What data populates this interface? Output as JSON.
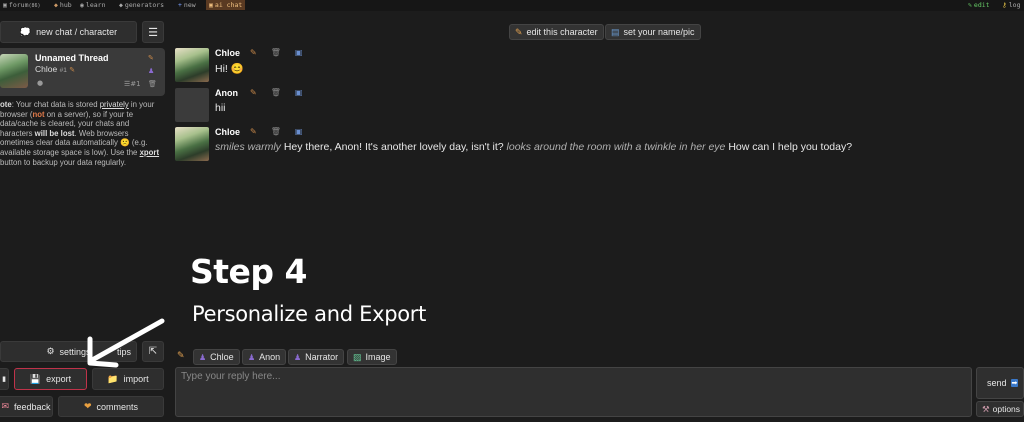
{
  "topnav": {
    "items": [
      {
        "icon": "▣",
        "label": "forum",
        "badge": "(86)"
      },
      {
        "icon": "◆",
        "label": "hub"
      },
      {
        "icon": "◉",
        "label": "learn"
      },
      {
        "icon": "◆",
        "label": "generators"
      },
      {
        "icon": "+",
        "label": "new"
      },
      {
        "icon": "▣",
        "label": "ai chat"
      }
    ],
    "right": [
      {
        "icon": "✎",
        "label": "edit"
      },
      {
        "icon": "⚷",
        "label": "log"
      }
    ]
  },
  "sidebar": {
    "new_chat_label": "new chat / character",
    "menu_icon": "☰",
    "thread": {
      "title": "Unnamed Thread",
      "character": "Chloe",
      "num": "#1",
      "msg_count": "#1"
    },
    "note": {
      "p1": "ote",
      "p2": ": Your chat data is stored ",
      "privately": "privately",
      "p3": " in your browser (",
      "not": "not",
      "p4": " on a server), so if your te data/cache is cleared, your chats and haracters ",
      "will_be_lost": "will be lost",
      "p5": ". Web browsers ometimes clear data automatically 🙁 (e.g. available storage space is low). Use the ",
      "export": "xport",
      "p6": " button to backup your data regularly."
    },
    "settings_label": "settings",
    "tips_label": "tips",
    "collapse_icon": "⇱",
    "export_label": "export",
    "import_label": "import",
    "feedback_label": "feedback",
    "comments_label": "comments"
  },
  "header": {
    "edit_character_label": "edit this character",
    "set_name_label": "set your name/pic"
  },
  "messages": [
    {
      "name": "Chloe",
      "text": "Hi! 😊"
    },
    {
      "name": "Anon",
      "text": "hii"
    },
    {
      "name": "Chloe",
      "action1": "smiles warmly",
      "speech1": " Hey there, Anon! It's another lovely day, isn't it? ",
      "action2": "looks around the room with a twinkle in her eye",
      "speech2": " How can I help you today?"
    }
  ],
  "overlay": {
    "step_title": "Step 4",
    "step_subtitle": "Personalize and Export"
  },
  "composer": {
    "chips": [
      "Chloe",
      "Anon",
      "Narrator",
      "Image"
    ],
    "placeholder": "Type your reply here...",
    "send_label": "send",
    "options_label": "options"
  }
}
